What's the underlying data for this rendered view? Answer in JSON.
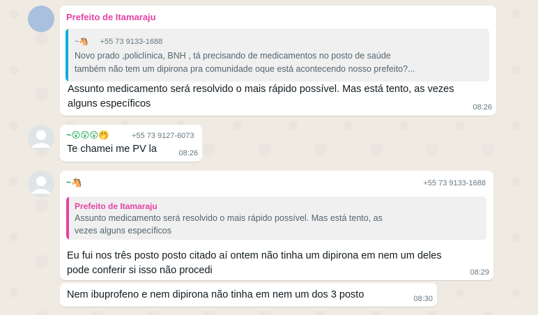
{
  "colors": {
    "chat_background": "#efeae2",
    "bubble": "#ffffff",
    "sender_pink": "#e542a3",
    "quote_bar_blue": "#06aed5",
    "quote_bar_pink": "#e542a3",
    "meta_gray": "#667781"
  },
  "messages": [
    {
      "sender_name": "Prefeito de Itamaraju",
      "quoted": {
        "author": "~🐴",
        "phone": "+55 73 9133-1688",
        "text_line1": "Novo prado ,policlínica, BNH , tá precisando de medicamentos no posto de saúde",
        "text_line2": "também não tem um dipirona pra comunidade oque está acontecendo nosso prefeito?..."
      },
      "text_line1": "Assunto medicamento será resolvido o mais rápido possível. Mas está tento, as vezes",
      "text_line2": "alguns específicos",
      "time": "08:26"
    },
    {
      "sender_name": "~😲😲😲🤭",
      "phone": "+55 73 9127-6073",
      "text": "Te chamei me PV la",
      "time": "08:26"
    },
    {
      "sender_name": "~🐴",
      "phone": "+55 73 9133-1688",
      "quoted": {
        "author": "Prefeito de Itamaraju",
        "text_line1": "Assunto medicamento será resolvido o mais rápido possível. Mas está tento, as",
        "text_line2": "vezes alguns específicos"
      },
      "text_line1": "Eu fui nos três posto posto citado aí ontem não tinha um dipirona em nem um deles",
      "text_line2": "pode conferir si isso não procedi",
      "time": "08:29"
    },
    {
      "text": "Nem ibuprofeno e nem dipirona não tinha em nem um dos 3 posto",
      "time": "08:30"
    }
  ]
}
